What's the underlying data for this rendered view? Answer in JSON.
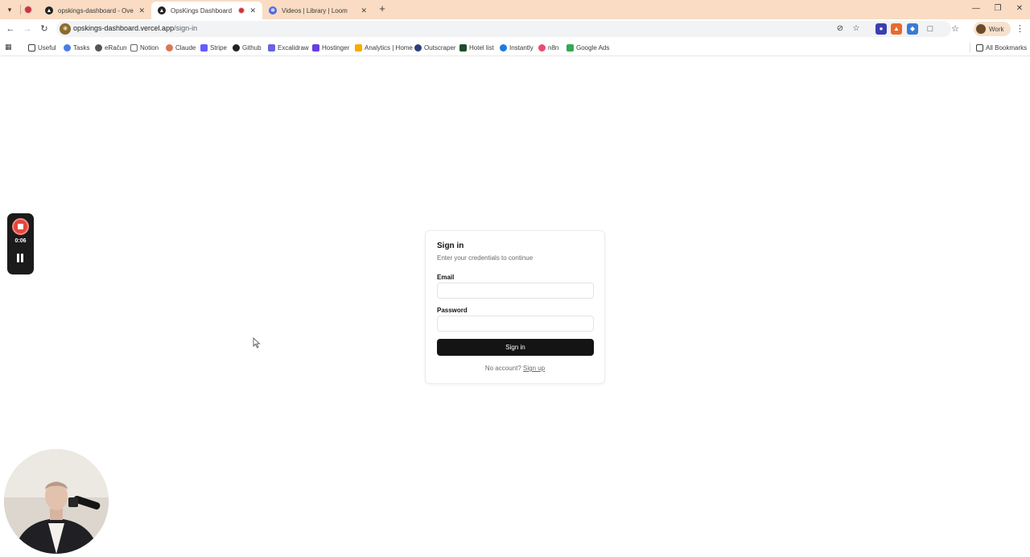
{
  "browser": {
    "tabs": [
      {
        "title": "opskings-dashboard - Overview",
        "active": false,
        "recording": false
      },
      {
        "title": "OpsKings Dashboard",
        "active": true,
        "recording": true
      },
      {
        "title": "Videos | Library | Loom",
        "active": false,
        "recording": false
      }
    ],
    "new_tab_icon": "plus-icon",
    "window_controls": [
      "minimize-icon",
      "restore-icon",
      "close-icon"
    ],
    "address": {
      "host": "opskings-dashboard.vercel.app",
      "path": "/sign-in"
    },
    "profile_label": "Work",
    "bookmarks": [
      "Useful",
      "Tasks",
      "eRačun",
      "Notion",
      "Claude",
      "Stripe",
      "Github",
      "Excalidraw",
      "Hostinger",
      "Analytics | Home",
      "Outscraper",
      "Hotel list",
      "Instantly",
      "n8n",
      "Google Ads"
    ],
    "all_bookmarks_label": "All Bookmarks"
  },
  "signin": {
    "title": "Sign in",
    "subtitle": "Enter your credentials to continue",
    "email_label": "Email",
    "email_value": "",
    "password_label": "Password",
    "password_value": "",
    "submit_label": "Sign in",
    "no_account_text": "No account?",
    "signup_link": "Sign up"
  },
  "recorder": {
    "elapsed": "0:06"
  },
  "colors": {
    "tabstrip": "#f9dcc3",
    "primary_button": "#141414",
    "record_red": "#e5473c"
  }
}
